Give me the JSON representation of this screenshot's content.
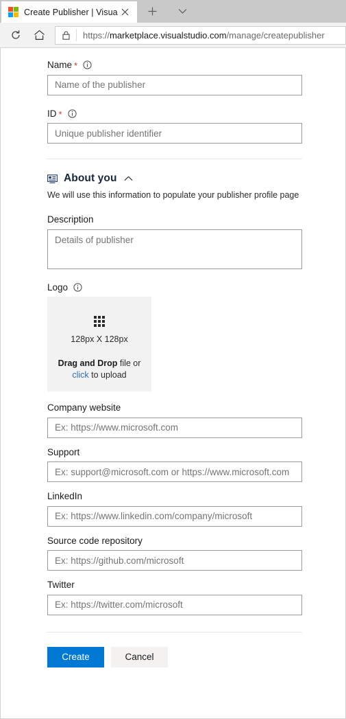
{
  "browser": {
    "tab": {
      "title": "Create Publisher | Visua",
      "favicon": "microsoft-logo",
      "close_label": "×"
    },
    "new_tab_label": "+",
    "tab_list_label": "∨",
    "toolbar": {
      "reload_label": "↻",
      "home_label": "⌂",
      "lock_label": "lock"
    },
    "address": {
      "scheme": "https://",
      "host": "marketplace.visualstudio.com",
      "path": "/manage/createpublisher"
    }
  },
  "form": {
    "name": {
      "label": "Name",
      "required_marker": "*",
      "placeholder": "Name of the publisher",
      "value": ""
    },
    "id": {
      "label": "ID",
      "required_marker": "*",
      "placeholder": "Unique publisher identifier",
      "value": ""
    },
    "about_section": {
      "title": "About you",
      "subtitle": "We will use this information to populate your publisher profile page",
      "collapse_label": "∧"
    },
    "description": {
      "label": "Description",
      "placeholder": "Details of publisher",
      "value": ""
    },
    "logo": {
      "label": "Logo",
      "dimensions": "128px X 128px",
      "drag_strong": "Drag and Drop",
      "drag_rest": " file or",
      "click_link": "click",
      "click_rest": " to upload"
    },
    "company_website": {
      "label": "Company website",
      "placeholder": "Ex: https://www.microsoft.com",
      "value": ""
    },
    "support": {
      "label": "Support",
      "placeholder": "Ex: support@microsoft.com or https://www.microsoft.com",
      "value": ""
    },
    "linkedin": {
      "label": "LinkedIn",
      "placeholder": "Ex: https://www.linkedin.com/company/microsoft",
      "value": ""
    },
    "source_repo": {
      "label": "Source code repository",
      "placeholder": "Ex: https://github.com/microsoft",
      "value": ""
    },
    "twitter": {
      "label": "Twitter",
      "placeholder": "Ex: https://twitter.com/microsoft",
      "value": ""
    },
    "actions": {
      "create_label": "Create",
      "cancel_label": "Cancel"
    }
  },
  "colors": {
    "primary_button": "#0078d4",
    "required_star": "#d13438",
    "link": "#2c6fb5",
    "dropzone_bg": "#f2f2f2"
  }
}
